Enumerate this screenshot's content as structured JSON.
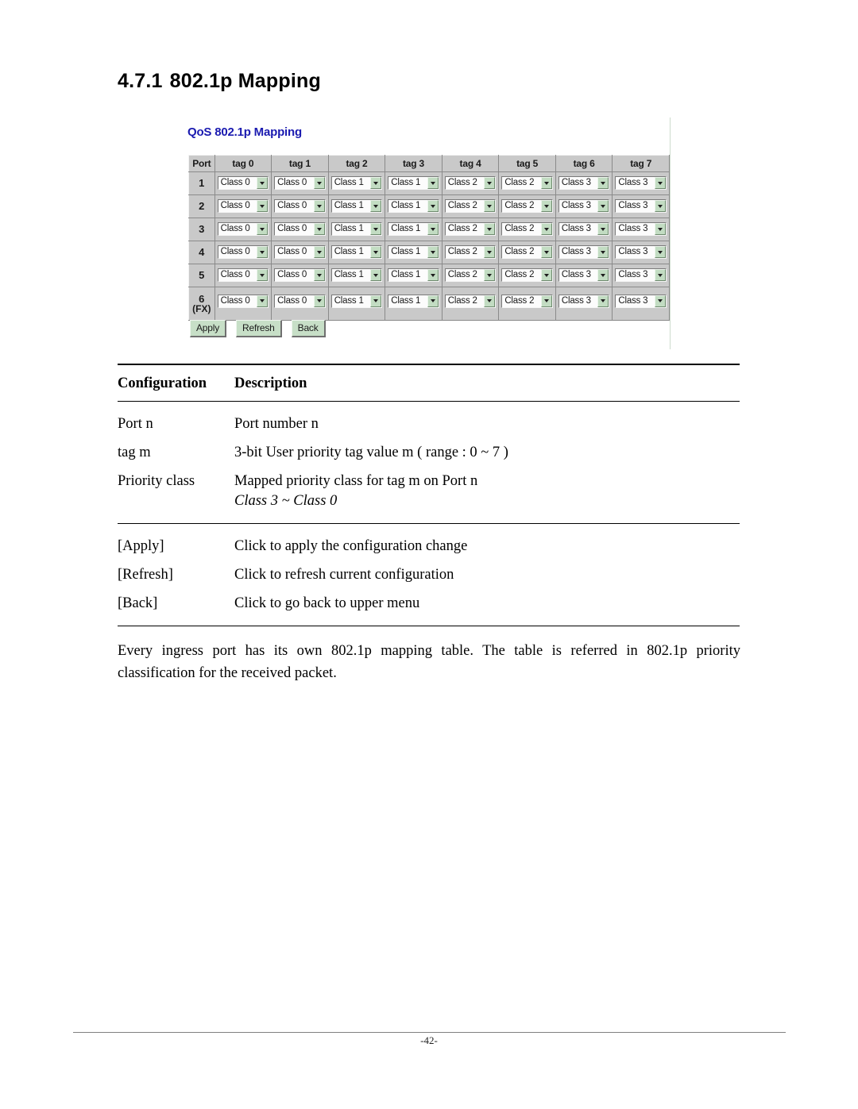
{
  "section": {
    "number": "4.7.1",
    "title": "802.1p Mapping"
  },
  "device_panel": {
    "title": "QoS 802.1p Mapping",
    "table": {
      "headers": [
        "Port",
        "tag 0",
        "tag 1",
        "tag 2",
        "tag 3",
        "tag 4",
        "tag 5",
        "tag 6",
        "tag 7"
      ],
      "rows": [
        {
          "port": "1",
          "port_sub": "",
          "values": [
            "Class 0",
            "Class 0",
            "Class 1",
            "Class 1",
            "Class 2",
            "Class 2",
            "Class 3",
            "Class 3"
          ]
        },
        {
          "port": "2",
          "port_sub": "",
          "values": [
            "Class 0",
            "Class 0",
            "Class 1",
            "Class 1",
            "Class 2",
            "Class 2",
            "Class 3",
            "Class 3"
          ]
        },
        {
          "port": "3",
          "port_sub": "",
          "values": [
            "Class 0",
            "Class 0",
            "Class 1",
            "Class 1",
            "Class 2",
            "Class 2",
            "Class 3",
            "Class 3"
          ]
        },
        {
          "port": "4",
          "port_sub": "",
          "values": [
            "Class 0",
            "Class 0",
            "Class 1",
            "Class 1",
            "Class 2",
            "Class 2",
            "Class 3",
            "Class 3"
          ]
        },
        {
          "port": "5",
          "port_sub": "",
          "values": [
            "Class 0",
            "Class 0",
            "Class 1",
            "Class 1",
            "Class 2",
            "Class 2",
            "Class 3",
            "Class 3"
          ]
        },
        {
          "port": "6",
          "port_sub": "(FX)",
          "values": [
            "Class 0",
            "Class 0",
            "Class 1",
            "Class 1",
            "Class 2",
            "Class 2",
            "Class 3",
            "Class 3"
          ]
        }
      ]
    },
    "buttons": [
      {
        "label": "Apply"
      },
      {
        "label": "Refresh"
      },
      {
        "label": "Back"
      }
    ],
    "colors": {
      "title_blue": "#1a1ab0",
      "button_green": "#c7dfc7",
      "cell_gray": "#c9c9c9",
      "arrow_green": "#c2dcc2"
    }
  },
  "desc_table": {
    "header": {
      "col1": "Configuration",
      "col2": "Description"
    },
    "group1": [
      {
        "config": "Port n",
        "description": "Port number n",
        "sub": ""
      },
      {
        "config": "tag m",
        "description": "3-bit User priority tag value m ( range : 0 ~ 7 )",
        "sub": ""
      },
      {
        "config": "Priority class",
        "description": "Mapped priority class for tag m on Port n",
        "sub": "Class 3 ~ Class 0"
      }
    ],
    "group2": [
      {
        "config": "[Apply]",
        "description": "Click to apply the configuration change",
        "sub": ""
      },
      {
        "config": "[Refresh]",
        "description": "Click to refresh current configuration",
        "sub": ""
      },
      {
        "config": "[Back]",
        "description": "Click to go back to upper menu",
        "sub": ""
      }
    ]
  },
  "paragraph": "Every ingress port has its own 802.1p mapping table. The table is referred in 802.1p priority classification for the received packet.",
  "footer": {
    "page_number": "-42-"
  }
}
